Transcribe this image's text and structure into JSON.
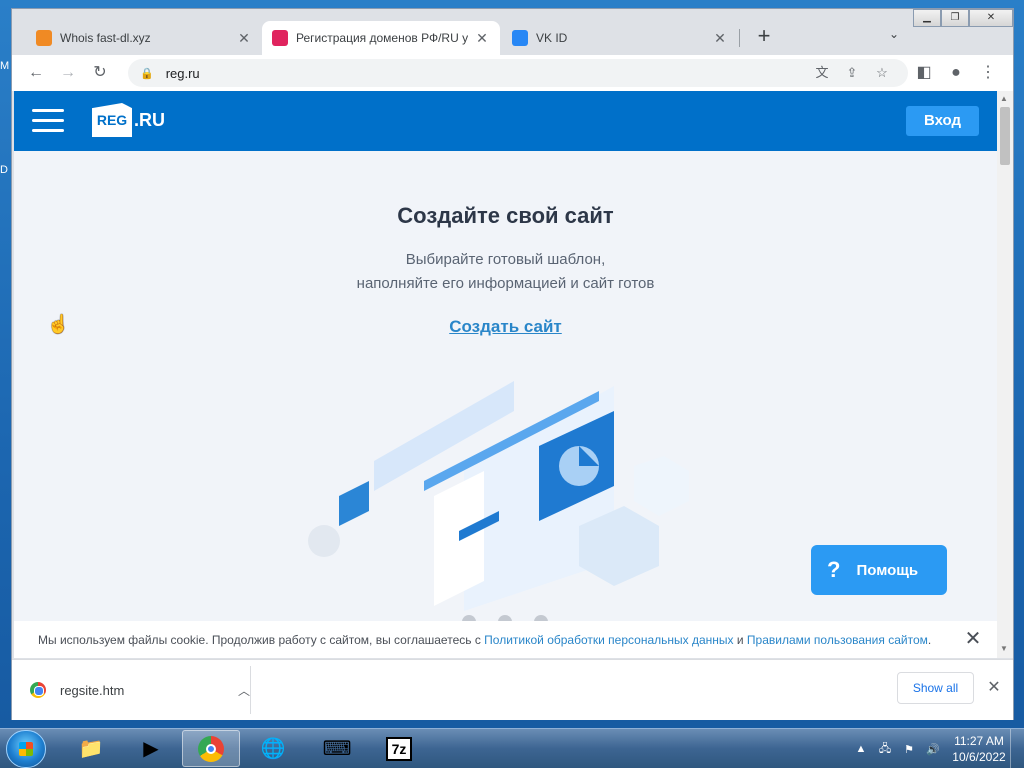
{
  "desktop": {
    "left_fragments": [
      "M",
      "D"
    ]
  },
  "browser": {
    "tabs": [
      {
        "title": "Whois fast-dl.xyz",
        "active": false,
        "favicon_color": "#f08a24"
      },
      {
        "title": "Регистрация доменов РФ/RU у",
        "active": true,
        "favicon_color": "#e0245e"
      },
      {
        "title": "VK ID",
        "active": false,
        "favicon_color": "#2787f5"
      }
    ],
    "new_tab_icon": "plus-icon",
    "tab_search_icon": "chevron-down-icon",
    "window_controls": [
      "minimize",
      "maximize",
      "close"
    ],
    "toolbar": {
      "url": "reg.ru",
      "icons": [
        "back-icon",
        "forward-icon",
        "reload-icon",
        "lock-icon",
        "translate-icon",
        "share-icon",
        "star-icon",
        "sidepanel-icon",
        "profile-icon",
        "menu-icon"
      ]
    }
  },
  "site": {
    "logo_mark": "REG",
    "logo_text": ".RU",
    "login_label": "Вход",
    "hero_title": "Создайте свой сайт",
    "hero_sub_1": "Выбирайте готовый шаблон,",
    "hero_sub_2": "наполняйте его информацией и сайт готов",
    "create_link": "Создать сайт",
    "help_label": "Помощь",
    "help_icon": "?",
    "carousel_dots": 3,
    "brand_color": "#0070c9",
    "accent_color": "#2b9af3"
  },
  "cookie": {
    "text_1": "Мы используем файлы cookie. Продолжив работу с сайтом, вы соглашаетесь с ",
    "link_1": "Политикой обработки персональных данных",
    "text_2": " и ",
    "link_2": "Правилами пользования сайтом",
    "text_3": "."
  },
  "downloads": {
    "file_name": "regsite.htm",
    "show_all_label": "Show all"
  },
  "taskbar": {
    "apps": [
      "explorer",
      "media-player",
      "chrome",
      "network-time",
      "keyboard",
      "7zip"
    ],
    "active_app": "chrome",
    "seven_zip_label": "7z",
    "time": "11:27 AM",
    "date": "10/6/2022"
  }
}
